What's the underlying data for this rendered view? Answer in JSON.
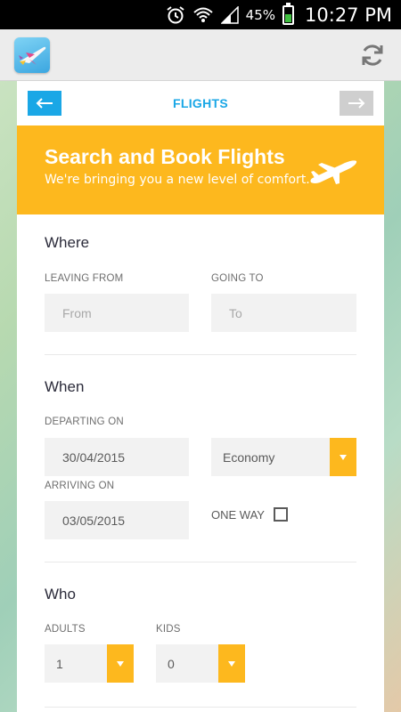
{
  "status_bar": {
    "battery_percent": "45%",
    "time": "10:27 PM",
    "icons": [
      "alarm-icon",
      "wifi-icon",
      "signal-icon",
      "battery-icon"
    ]
  },
  "app_bar": {
    "logo_icon": "airplane-logo-icon",
    "refresh_icon": "refresh-icon"
  },
  "nav": {
    "title": "FLIGHTS",
    "back_icon": "arrow-left-icon",
    "forward_icon": "arrow-right-icon"
  },
  "hero": {
    "title": "Search and Book Flights",
    "subtitle": "We're bringing you a new level of comfort.",
    "icon": "airplane-icon"
  },
  "where": {
    "title": "Where",
    "leaving_label": "LEAVING FROM",
    "leaving_placeholder": "From",
    "going_label": "GOING TO",
    "going_placeholder": "To"
  },
  "when": {
    "title": "When",
    "departing_label": "DEPARTING ON",
    "departing_value": "30/04/2015",
    "class_value": "Economy",
    "arriving_label": "ARRIVING ON",
    "arriving_value": "03/05/2015",
    "one_way_label": "ONE WAY",
    "one_way_checked": false
  },
  "who": {
    "title": "Who",
    "adults_label": "ADULTS",
    "adults_value": "1",
    "kids_label": "KIDS",
    "kids_value": "0"
  },
  "colors": {
    "accent_blue": "#1aa7e6",
    "accent_yellow": "#fdb81e"
  }
}
